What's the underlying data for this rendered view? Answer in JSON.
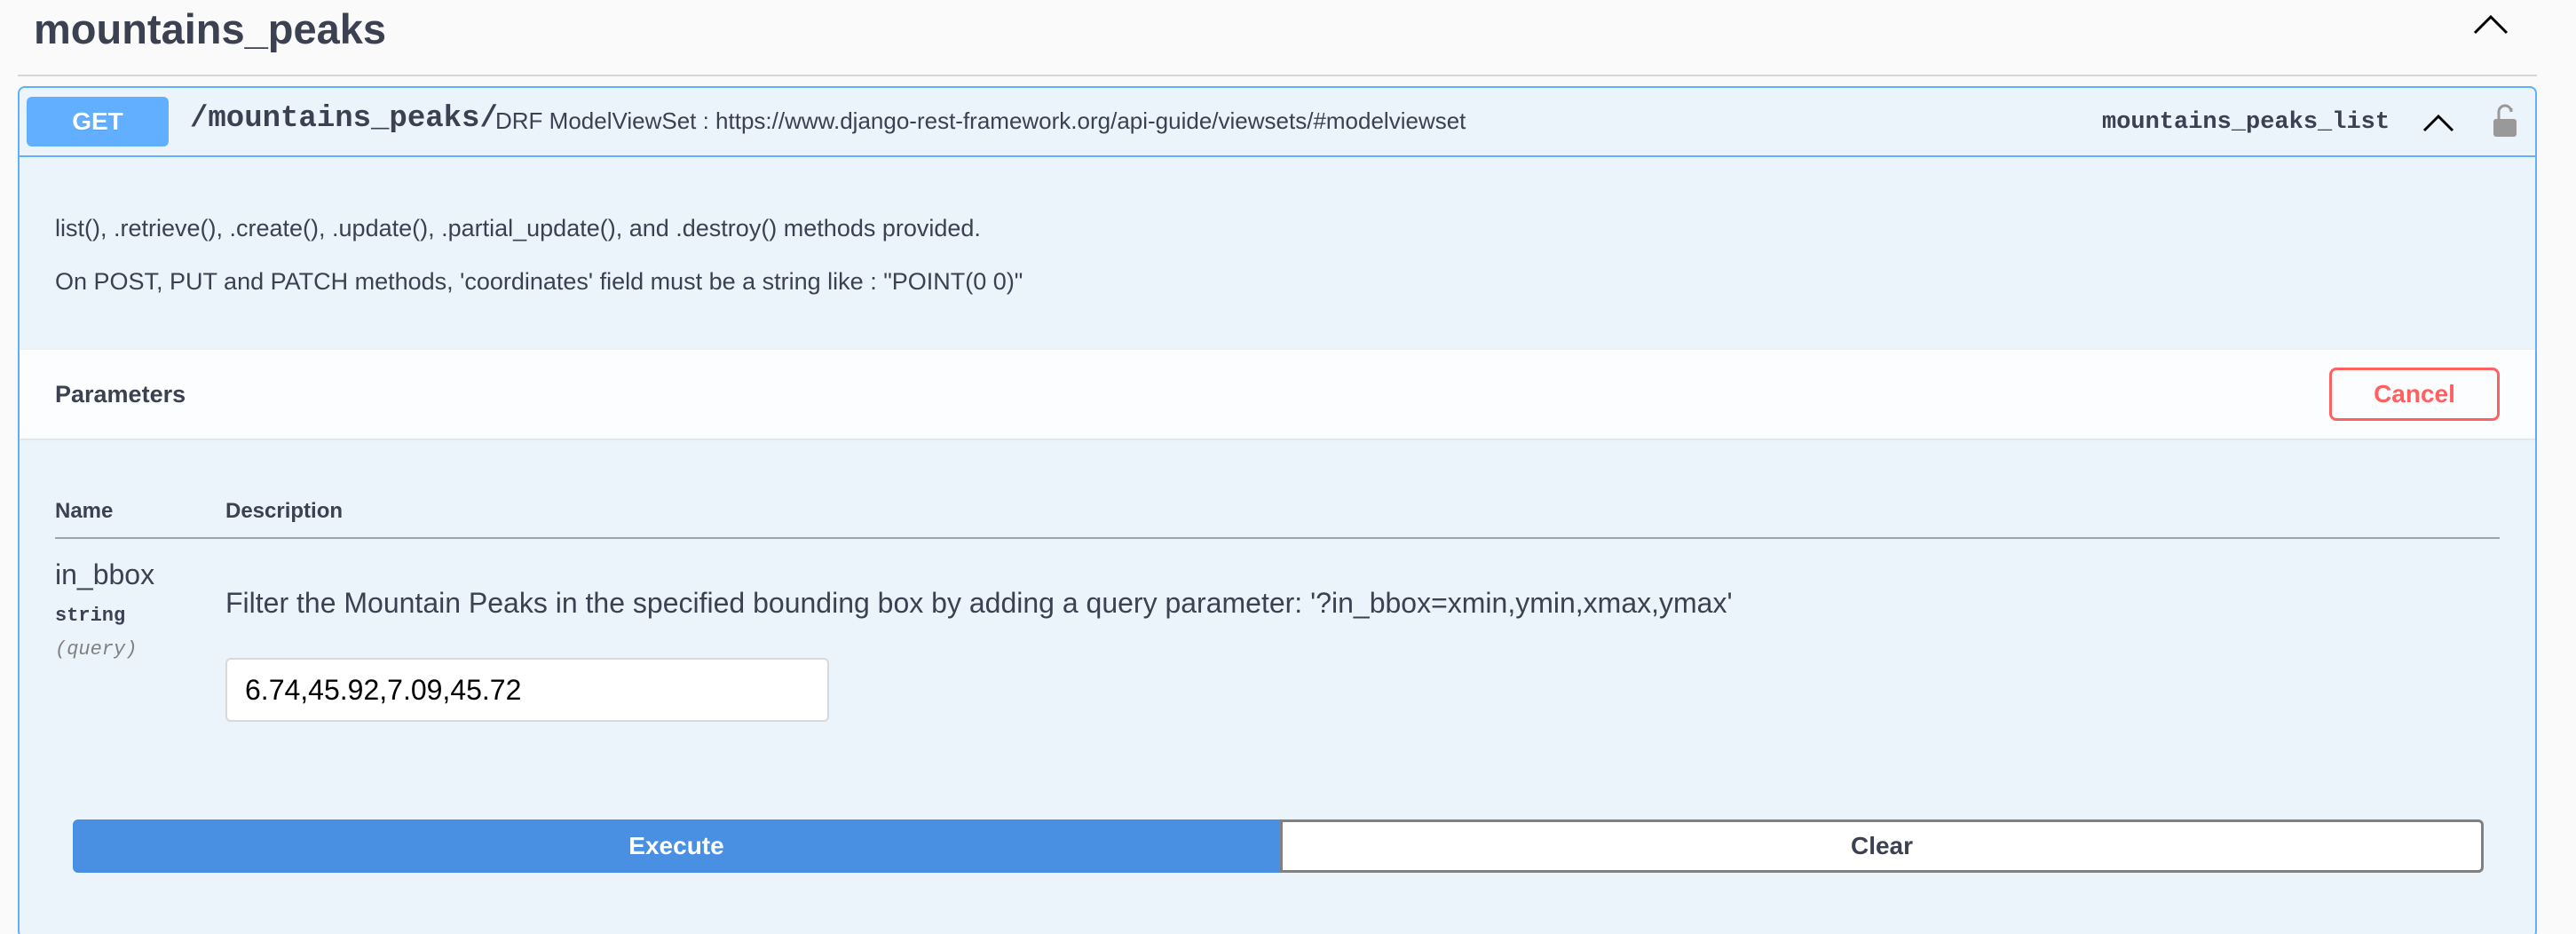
{
  "tag": {
    "title": "mountains_peaks",
    "toggle_icon": "chevron-up-icon"
  },
  "operation": {
    "method": "GET",
    "path": "/mountains_peaks/",
    "summary": "DRF ModelViewSet : https://www.django-rest-framework.org/api-guide/viewsets/#modelviewset",
    "operation_id": "mountains_peaks_list",
    "collapse_icon": "chevron-up-icon",
    "lock_icon": "unlocked-lock-icon",
    "description": [
      "list(), .retrieve(), .create(), .update(), .partial_update(), and .destroy() methods provided.",
      "On POST, PUT and PATCH methods, 'coordinates' field must be a string like : \"POINT(0 0)\""
    ]
  },
  "parameters": {
    "title": "Parameters",
    "cancel_label": "Cancel",
    "columns": [
      "Name",
      "Description"
    ],
    "items": [
      {
        "name": "in_bbox",
        "type": "string",
        "in": "(query)",
        "description": "Filter the Mountain Peaks in the specified bounding box by adding a query parameter: '?in_bbox=xmin,ymin,xmax,ymax'",
        "value": "6.74,45.92,7.09,45.72"
      }
    ]
  },
  "actions": {
    "execute_label": "Execute",
    "clear_label": "Clear"
  },
  "colors": {
    "get_method": "#61affe",
    "opblock_bg": "#ebf3fb",
    "execute": "#4990e2",
    "cancel": "#ff6060",
    "text": "#3b4151"
  }
}
